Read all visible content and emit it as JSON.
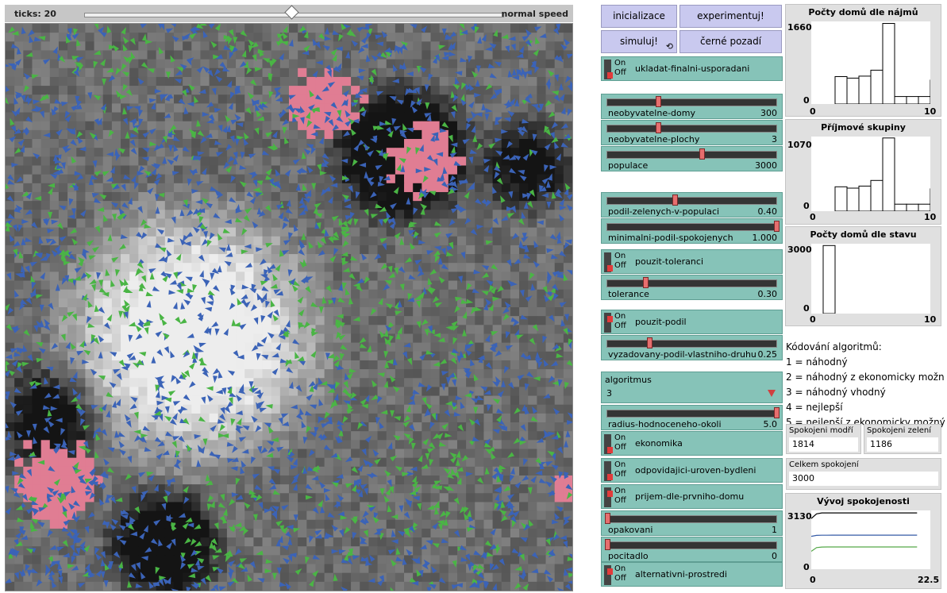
{
  "view": {
    "ticks_label": "ticks: 20",
    "speed_label": "normal speed"
  },
  "buttons": {
    "inicializace": "inicializace",
    "experimentuj": "experimentuj!",
    "simuluj": "simuluj!",
    "cerne_pozadi": "černé pozadí"
  },
  "switches": {
    "ukladat": {
      "label": "ukladat-finalni-usporadani",
      "on": false
    },
    "pouzit_toleranci": {
      "label": "pouzit-toleranci",
      "on": false
    },
    "pouzit_podil": {
      "label": "pouzit-podil",
      "on": false
    },
    "ekonomika": {
      "label": "ekonomika",
      "on": false
    },
    "odpovidajici": {
      "label": "odpovidajici-uroven-bydleni",
      "on": false
    },
    "prijem": {
      "label": "prijem-dle-prvniho-domu",
      "on": false
    },
    "alternativni": {
      "label": "alternativni-prostredi",
      "on": false
    },
    "on_text": "On",
    "off_text": "Off"
  },
  "sliders": {
    "neobyvatelne_domy": {
      "label": "neobyvatelne-domy",
      "value": "300",
      "fraction": 0.3
    },
    "neobyvatelne_plochy": {
      "label": "neobyvatelne-plochy",
      "value": "3",
      "fraction": 0.3
    },
    "populace": {
      "label": "populace",
      "value": "3000",
      "fraction": 0.56
    },
    "podil_zelenych": {
      "label": "podil-zelenych-v-populaci",
      "value": "0.40",
      "fraction": 0.4
    },
    "minimalni_podil": {
      "label": "minimalni-podil-spokojenych",
      "value": "1.000",
      "fraction": 1.0
    },
    "tolerance": {
      "label": "tolerance",
      "value": "0.30",
      "fraction": 0.22
    },
    "vyzadovany_podil": {
      "label": "vyzadovany-podil-vlastniho-druhu",
      "value": "0.25",
      "fraction": 0.25
    },
    "radius": {
      "label": "radius-hodnoceneho-okoli",
      "value": "5.0",
      "fraction": 1.0
    },
    "opakovani": {
      "label": "opakovani",
      "value": "1",
      "fraction": 0.0
    },
    "pocitadlo": {
      "label": "pocitadlo",
      "value": "0",
      "fraction": 0.0
    }
  },
  "chooser": {
    "label": "algoritmus",
    "value": "3"
  },
  "notes": {
    "title": "Kódování algoritmů:",
    "lines": [
      "1 = náhodný",
      "2 = náhodný z ekonomicky možn",
      "3 = náhodný vhodný",
      "4 = nejlepší",
      "5 = nejlepší z ekonomicky možný"
    ]
  },
  "monitors": {
    "spokojeni_modri": {
      "label": "Spokojeni modří",
      "value": "1814"
    },
    "spokojeni_zeleni": {
      "label": "Spokojeni zelení",
      "value": "1186"
    },
    "celkem": {
      "label": "Celkem spokojení",
      "value": "3000"
    }
  },
  "plots": {
    "najmy": {
      "title": "Počty domů dle nájmů",
      "ymax": "1660",
      "ymin": "0",
      "xmin": "0",
      "xmax": "10",
      "chart_data": {
        "type": "bar",
        "xlim": [
          0,
          10
        ],
        "ylim": [
          0,
          1660
        ],
        "values": [
          0,
          0,
          550,
          520,
          560,
          680,
          1620,
          150,
          150,
          150,
          480
        ]
      }
    },
    "prijmove": {
      "title": "Příjmové skupiny",
      "ymax": "1070",
      "ymin": "0",
      "xmin": "0",
      "xmax": "10",
      "chart_data": {
        "type": "bar",
        "xlim": [
          0,
          10
        ],
        "ylim": [
          0,
          1070
        ],
        "values": [
          0,
          0,
          350,
          330,
          360,
          440,
          1050,
          100,
          100,
          100,
          320
        ]
      }
    },
    "stav": {
      "title": "Počty domů dle stavu",
      "ymax": "3000",
      "ymin": "0",
      "xmin": "0",
      "xmax": "10",
      "chart_data": {
        "type": "bar",
        "xlim": [
          0,
          10
        ],
        "ylim": [
          0,
          3000
        ],
        "values": [
          0,
          2920,
          0,
          0,
          0,
          0,
          0,
          0,
          0,
          0
        ]
      }
    },
    "vyvoj": {
      "title": "Vývoj spokojenosti",
      "ymax": "3130",
      "ymin": "0",
      "xmin": "0",
      "xmax": "22.5",
      "chart_data": {
        "type": "line",
        "xlim": [
          0,
          22.5
        ],
        "ylim": [
          0,
          3130
        ],
        "series": [
          {
            "color": "#000000",
            "values": [
              2700,
              2950,
              3000,
              3000,
              3000,
              3000,
              3000,
              3000,
              3000,
              3000,
              3000,
              3000,
              3000,
              3000,
              3000,
              3000,
              3000,
              3000,
              3000,
              3000,
              3000
            ]
          },
          {
            "color": "#345aa6",
            "values": [
              1750,
              1800,
              1810,
              1812,
              1814,
              1814,
              1814,
              1814,
              1814,
              1814,
              1814,
              1814,
              1814,
              1814,
              1814,
              1814,
              1814,
              1814,
              1814,
              1814,
              1814
            ]
          },
          {
            "color": "#54a848",
            "values": [
              950,
              1150,
              1180,
              1186,
              1186,
              1186,
              1186,
              1186,
              1186,
              1186,
              1186,
              1186,
              1186,
              1186,
              1186,
              1186,
              1186,
              1186,
              1186,
              1186,
              1186
            ]
          }
        ]
      }
    }
  },
  "colors": {
    "blue_agent": "#3b63b7",
    "green_agent": "#4ab545",
    "pink_patch": "#e07d93"
  }
}
